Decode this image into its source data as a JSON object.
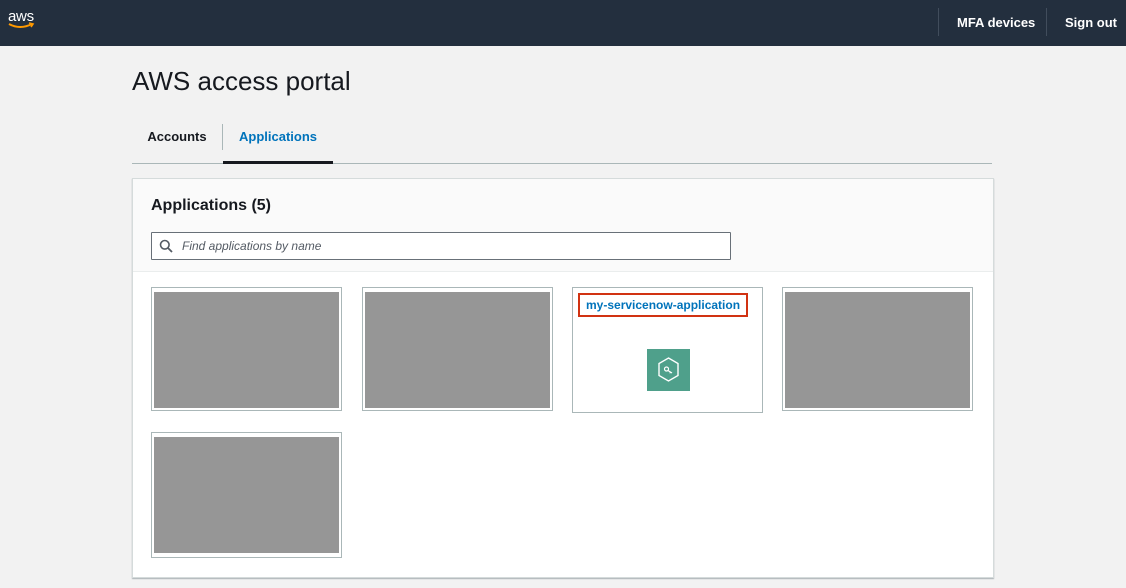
{
  "header": {
    "logo_text": "aws",
    "mfa_label": "MFA devices",
    "signout_label": "Sign out"
  },
  "page": {
    "title": "AWS access portal"
  },
  "tabs": [
    {
      "label": "Accounts",
      "selected": false
    },
    {
      "label": "Applications",
      "selected": true
    }
  ],
  "applications": {
    "heading": "Applications (5)",
    "search_placeholder": "Find applications by name",
    "search_value": "",
    "items": [
      {
        "name": "",
        "redacted": true
      },
      {
        "name": "",
        "redacted": true
      },
      {
        "name": "my-servicenow-application",
        "redacted": false,
        "icon": "key-hexagon-icon",
        "highlighted": true
      },
      {
        "name": "",
        "redacted": true
      },
      {
        "name": "",
        "redacted": true
      }
    ]
  },
  "colors": {
    "topbar": "#232f3e",
    "link": "#0073bb",
    "highlight_border": "#d13212",
    "app_icon": "#4fa08b",
    "redacted": "#969696"
  }
}
